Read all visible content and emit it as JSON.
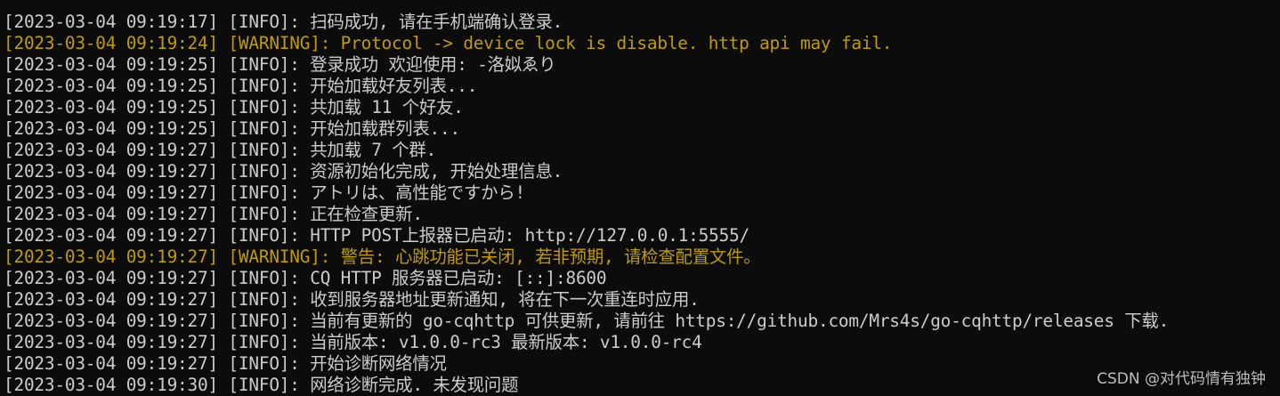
{
  "terminal": {
    "colors": {
      "background": "#0c0c0c",
      "info_text": "#cccccc",
      "warning_text": "#c19c00"
    },
    "lines": [
      {
        "level": "info",
        "text": "[2023-03-04 09:19:17] [INFO]: 扫码成功, 请在手机端确认登录."
      },
      {
        "level": "warning",
        "text": "[2023-03-04 09:19:24] [WARNING]: Protocol -> device lock is disable. http api may fail."
      },
      {
        "level": "info",
        "text": "[2023-03-04 09:19:25] [INFO]: 登录成功 欢迎使用: -洛姒ゑり"
      },
      {
        "level": "info",
        "text": "[2023-03-04 09:19:25] [INFO]: 开始加载好友列表..."
      },
      {
        "level": "info",
        "text": "[2023-03-04 09:19:25] [INFO]: 共加载 11 个好友."
      },
      {
        "level": "info",
        "text": "[2023-03-04 09:19:25] [INFO]: 开始加载群列表..."
      },
      {
        "level": "info",
        "text": "[2023-03-04 09:19:27] [INFO]: 共加载 7 个群."
      },
      {
        "level": "info",
        "text": "[2023-03-04 09:19:27] [INFO]: 资源初始化完成, 开始处理信息."
      },
      {
        "level": "info",
        "text": "[2023-03-04 09:19:27] [INFO]: アトリは、高性能ですから!"
      },
      {
        "level": "info",
        "text": "[2023-03-04 09:19:27] [INFO]: 正在检查更新."
      },
      {
        "level": "info",
        "text": "[2023-03-04 09:19:27] [INFO]: HTTP POST上报器已启动: http://127.0.0.1:5555/"
      },
      {
        "level": "warning",
        "text": "[2023-03-04 09:19:27] [WARNING]: 警告: 心跳功能已关闭, 若非预期, 请检查配置文件。"
      },
      {
        "level": "info",
        "text": "[2023-03-04 09:19:27] [INFO]: CQ HTTP 服务器已启动: [::]:8600"
      },
      {
        "level": "info",
        "text": "[2023-03-04 09:19:27] [INFO]: 收到服务器地址更新通知, 将在下一次重连时应用."
      },
      {
        "level": "info",
        "text": "[2023-03-04 09:19:27] [INFO]: 当前有更新的 go-cqhttp 可供更新, 请前往 https://github.com/Mrs4s/go-cqhttp/releases 下载."
      },
      {
        "level": "info",
        "text": "[2023-03-04 09:19:27] [INFO]: 当前版本: v1.0.0-rc3 最新版本: v1.0.0-rc4"
      },
      {
        "level": "info",
        "text": "[2023-03-04 09:19:27] [INFO]: 开始诊断网络情况"
      },
      {
        "level": "info",
        "text": "[2023-03-04 09:19:30] [INFO]: 网络诊断完成. 未发现问题"
      }
    ]
  },
  "watermark": {
    "text": "CSDN @对代码情有独钟"
  }
}
